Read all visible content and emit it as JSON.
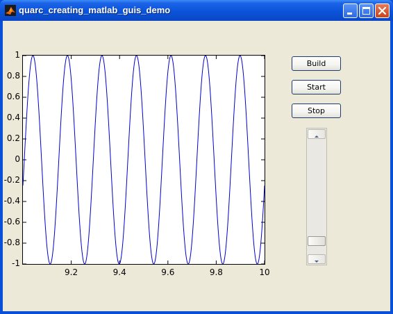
{
  "window": {
    "title": "quarc_creating_matlab_guis_demo",
    "icon": "matlab-logo-icon",
    "controls": [
      "minimize-icon",
      "maximize-icon",
      "close-icon"
    ]
  },
  "controls": {
    "build_label": "Build",
    "start_label": "Start",
    "stop_label": "Stop",
    "slider": {
      "value_fraction": 0.0
    }
  },
  "colors": {
    "titlebar": "#0a54da",
    "panel": "#ece9d8",
    "line": "#0000cc",
    "close_button": "#c8451c"
  },
  "chart_data": {
    "type": "line",
    "title": "",
    "xlabel": "",
    "ylabel": "",
    "xlim": [
      9.0,
      10.0
    ],
    "ylim": [
      -1,
      1
    ],
    "x_ticks": [
      "9.2",
      "9.4",
      "9.6",
      "9.8",
      "10"
    ],
    "y_ticks": [
      "1",
      "0.8",
      "0.6",
      "0.4",
      "0.2",
      "0",
      "-0.2",
      "-0.4",
      "-0.6",
      "-0.8",
      "-1"
    ],
    "grid": false,
    "series": [
      {
        "function": "sin",
        "amplitude": 1,
        "frequency_hz": 7,
        "phase": -0.25
      }
    ]
  }
}
